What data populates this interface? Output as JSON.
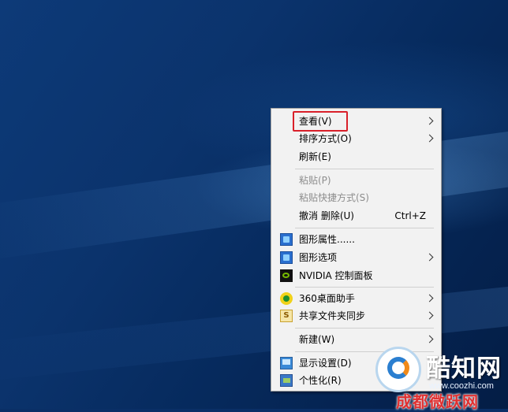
{
  "context_menu": {
    "items": [
      {
        "label": "查看(V)",
        "shortcut": "",
        "submenu": true,
        "enabled": true,
        "icon": ""
      },
      {
        "label": "排序方式(O)",
        "shortcut": "",
        "submenu": true,
        "enabled": true,
        "icon": ""
      },
      {
        "label": "刷新(E)",
        "shortcut": "",
        "submenu": false,
        "enabled": true,
        "icon": ""
      },
      {
        "label": "粘贴(P)",
        "shortcut": "",
        "submenu": false,
        "enabled": false,
        "icon": ""
      },
      {
        "label": "粘贴快捷方式(S)",
        "shortcut": "",
        "submenu": false,
        "enabled": false,
        "icon": ""
      },
      {
        "label": "撤消 删除(U)",
        "shortcut": "Ctrl+Z",
        "submenu": false,
        "enabled": true,
        "icon": ""
      },
      {
        "label": "图形属性......",
        "shortcut": "",
        "submenu": false,
        "enabled": true,
        "icon": "graphics-icon"
      },
      {
        "label": "图形选项",
        "shortcut": "",
        "submenu": true,
        "enabled": true,
        "icon": "graphics-icon"
      },
      {
        "label": "NVIDIA 控制面板",
        "shortcut": "",
        "submenu": false,
        "enabled": true,
        "icon": "nvidia-icon"
      },
      {
        "label": "360桌面助手",
        "shortcut": "",
        "submenu": true,
        "enabled": true,
        "icon": "360-icon"
      },
      {
        "label": "共享文件夹同步",
        "shortcut": "",
        "submenu": true,
        "enabled": true,
        "icon": "share-sync-icon"
      },
      {
        "label": "新建(W)",
        "shortcut": "",
        "submenu": true,
        "enabled": true,
        "icon": ""
      },
      {
        "label": "显示设置(D)",
        "shortcut": "",
        "submenu": false,
        "enabled": true,
        "icon": "display-icon"
      },
      {
        "label": "个性化(R)",
        "shortcut": "",
        "submenu": false,
        "enabled": true,
        "icon": "personalize-icon"
      }
    ],
    "highlighted_item": "查看(V)",
    "highlight_color": "#d9202a"
  },
  "watermark": {
    "brand": "酷知网",
    "url": "www.coozhi.com",
    "site": "成都微跃网",
    "share_icon_glyph": "S"
  }
}
